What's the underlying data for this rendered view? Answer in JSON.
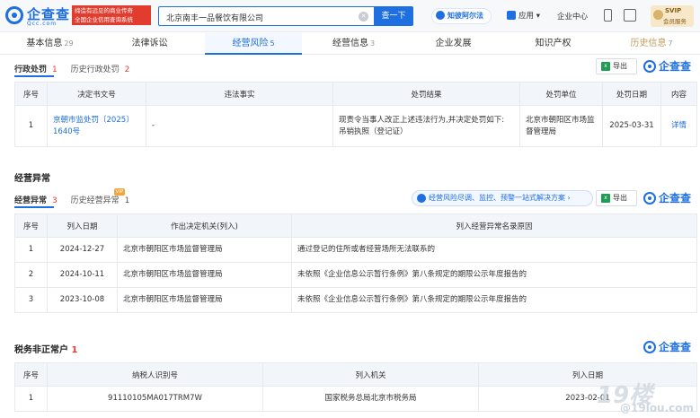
{
  "header": {
    "logo_name": "企查查",
    "logo_domain": "Qcc.com",
    "slogan_line1": "缔造有远见的商业传奇",
    "slogan_line2": "全国企业信用查询系统",
    "search_value": "北京南丰一品餐饮有限公司",
    "search_button": "查一下",
    "zhiyu": "知彼阿尔法",
    "apps": "应用",
    "enterprise_center": "企业中心",
    "svip_line1": "SVIP",
    "svip_line2": "会员服务"
  },
  "tabs": [
    {
      "label": "基本信息",
      "count": "29"
    },
    {
      "label": "法律诉讼",
      "count": ""
    },
    {
      "label": "经营风险",
      "count": "5"
    },
    {
      "label": "经营信息",
      "count": "3"
    },
    {
      "label": "企业发展",
      "count": ""
    },
    {
      "label": "知识产权",
      "count": ""
    },
    {
      "label": "历史信息",
      "count": "7"
    }
  ],
  "admin_penalty": {
    "subtab_active": "行政处罚",
    "subtab_active_count": "1",
    "subtab_history": "历史行政处罚",
    "subtab_history_count": "2",
    "export": "导出",
    "brand": "企查查",
    "columns": [
      "序号",
      "决定书文号",
      "违法事实",
      "处罚结果",
      "处罚单位",
      "处罚日期",
      "内容"
    ],
    "rows": [
      {
        "no": "1",
        "doc_no_1": "京朝市监处罚〔2025〕",
        "doc_no_2": "1640号",
        "fact": "-",
        "result_1": "现责令当事人改正上述违法行为,并决定处罚如下:",
        "result_2": "吊销执照（登记证）",
        "unit_1": "北京市朝阳区市场监",
        "unit_2": "督管理局",
        "date": "2025-03-31",
        "detail": "详情"
      }
    ]
  },
  "abnormal": {
    "title": "经营异常",
    "subtab_active": "经营异常",
    "subtab_active_count": "3",
    "subtab_history": "历史经营异常",
    "subtab_history_count": "1",
    "vip": "VIP",
    "promo": "经营风险尽调、监控、预警一站式解决方案",
    "export": "导出",
    "brand": "企查查",
    "columns": [
      "序号",
      "列入日期",
      "作出决定机关(列入)",
      "列入经营异常名录原因"
    ],
    "rows": [
      {
        "no": "1",
        "date": "2024-12-27",
        "org": "北京市朝阳区市场监督管理局",
        "reason": "通过登记的住所或者经营场所无法联系的"
      },
      {
        "no": "2",
        "date": "2024-10-11",
        "org": "北京市朝阳区市场监督管理局",
        "reason": "未依照《企业信息公示暂行条例》第八条规定的期限公示年度报告的"
      },
      {
        "no": "3",
        "date": "2023-10-08",
        "org": "北京市朝阳区市场监督管理局",
        "reason": "未依照《企业信息公示暂行条例》第八条规定的期限公示年度报告的"
      }
    ]
  },
  "tax": {
    "title": "税务非正常户",
    "count": "1",
    "brand": "企查查",
    "columns": [
      "序号",
      "纳税人识别号",
      "列入机关",
      "列入日期"
    ],
    "rows": [
      {
        "no": "1",
        "tax_id": "91110105MA017TRM7W",
        "org": "国家税务总局北京市税务局",
        "date": "2023-02-01"
      }
    ]
  },
  "watermark": "19楼",
  "watermark_sub": "@19lou.com"
}
